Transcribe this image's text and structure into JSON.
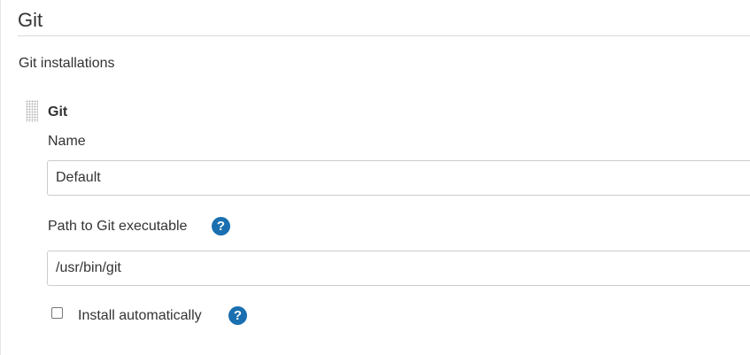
{
  "section": {
    "title": "Git"
  },
  "installations": {
    "label": "Git installations",
    "items": [
      {
        "title": "Git",
        "name_label": "Name",
        "name_value": "Default",
        "path_label": "Path to Git executable",
        "path_value": "/usr/bin/git",
        "install_label": "Install automatically",
        "install_checked": false,
        "help_icon": "question-mark",
        "help_glyph": "?"
      }
    ]
  },
  "colors": {
    "help_icon_bg": "#1a6fb0",
    "text": "#333333",
    "border": "#cccccc"
  }
}
